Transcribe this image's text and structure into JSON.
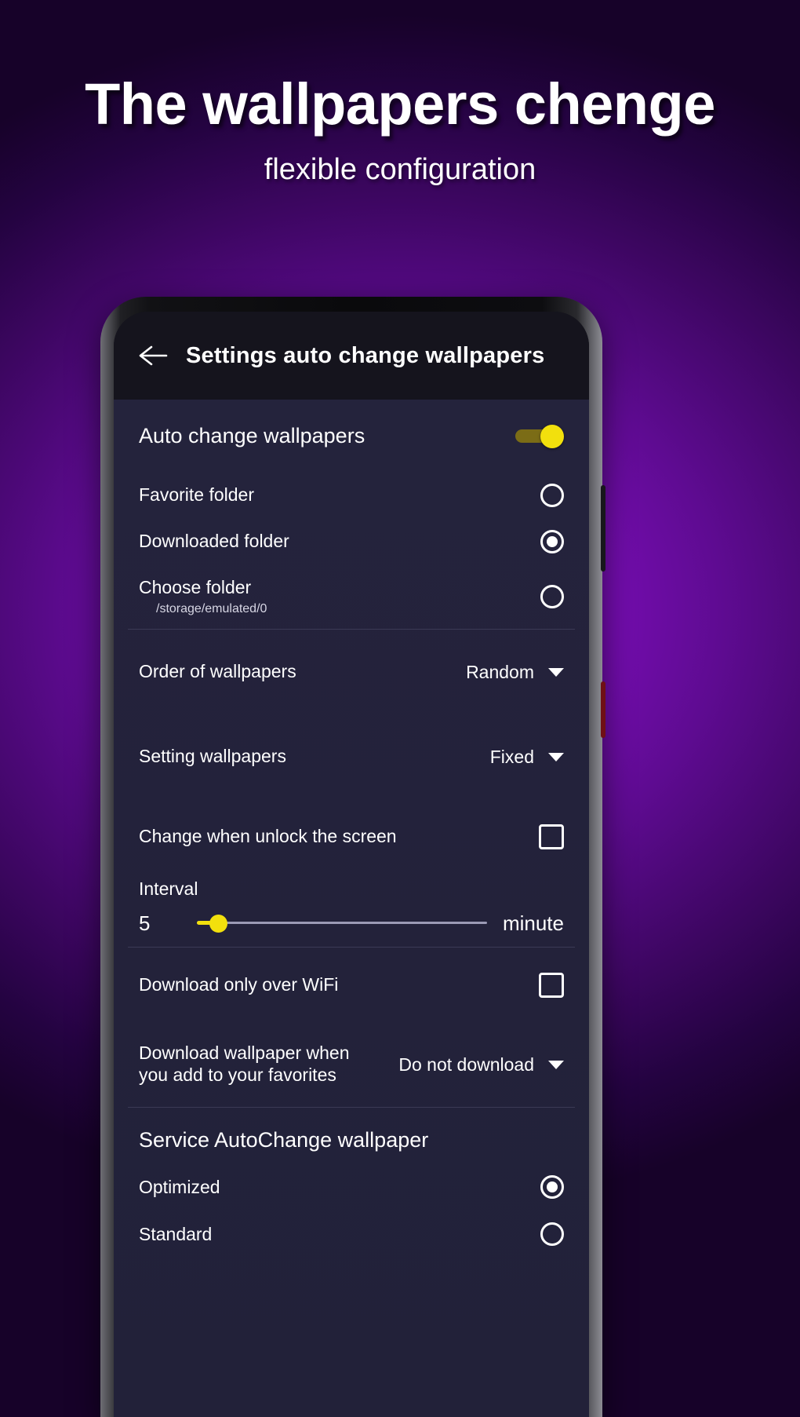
{
  "promo": {
    "title": "The wallpapers chenge",
    "subtitle": "flexible configuration"
  },
  "colors": {
    "accent_yellow": "#f2e00d",
    "toggle_track": "#7b6c16",
    "screen_bg": "#23223a",
    "appbar_bg": "#15141d",
    "text_primary": "#ffffff",
    "text_secondary": "#d7d6e4",
    "divider": "#3b3a55",
    "slider_track": "#9b9ab5"
  },
  "appbar": {
    "back_icon": "arrow-left-icon",
    "title": "Settings auto change wallpapers"
  },
  "main_toggle": {
    "label": "Auto change wallpapers",
    "state": "on"
  },
  "folder_options": [
    {
      "label": "Favorite folder",
      "selected": false
    },
    {
      "label": "Downloaded folder",
      "selected": true
    },
    {
      "label": "Choose folder",
      "path": "/storage/emulated/0",
      "selected": false
    }
  ],
  "dropdowns": [
    {
      "label": "Order of wallpapers",
      "value": "Random",
      "icon": "chevron-down-icon"
    },
    {
      "label": "Setting wallpapers",
      "value": "Fixed",
      "icon": "chevron-down-icon"
    }
  ],
  "checkbox_unlock": {
    "label": "Change when unlock the screen",
    "checked": false
  },
  "interval": {
    "title": "Interval",
    "value": "5",
    "unit": "minute",
    "percent": 4
  },
  "checkbox_wifi": {
    "label": "Download only over WiFi",
    "checked": false
  },
  "download_dropdown": {
    "label": "Download wallpaper when you add to your favorites",
    "label_line1": "Download wallpaper when",
    "label_line2": "you add to your favorites",
    "value": "Do not download",
    "icon": "chevron-down-icon"
  },
  "service": {
    "title": "Service AutoChange wallpaper",
    "options": [
      {
        "label": "Optimized",
        "selected": true
      },
      {
        "label": "Standard",
        "selected": false
      }
    ]
  }
}
